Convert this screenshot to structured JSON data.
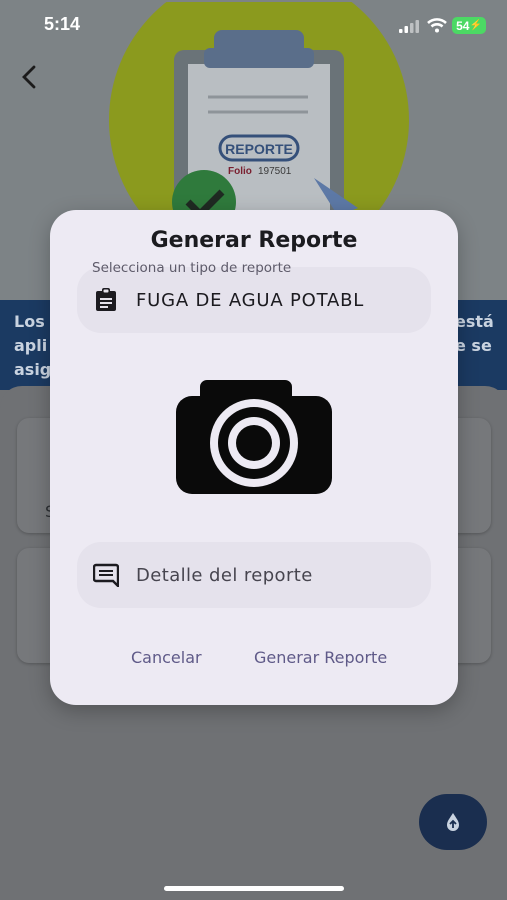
{
  "status_bar": {
    "time": "5:14",
    "battery": "54"
  },
  "hero": {
    "badge": "REPORTE",
    "folio_label": "Folio",
    "folio_number": "197501"
  },
  "background": {
    "band_left": [
      "Los",
      "apli",
      "asig"
    ],
    "band_right": [
      "está",
      "e se",
      ""
    ],
    "card_fragment": "S"
  },
  "dialog": {
    "title": "Generar Reporte",
    "select_label": "Selecciona un tipo de reporte",
    "report_type_value": "FUGA DE AGUA POTABL",
    "detail_placeholder": "Detalle del reporte",
    "cancel_label": "Cancelar",
    "generate_label": "Generar Reporte"
  },
  "icons": {
    "back": "chevron-left-icon",
    "clipboard": "clipboard-icon",
    "camera": "camera-icon",
    "comment": "comment-icon",
    "fab": "upload-icon"
  },
  "colors": {
    "dialog_bg": "#edeaf3",
    "field_bg": "#e5e2ec",
    "action_text": "#5f5a88",
    "band": "#1b3a62",
    "fab": "#1a2e4f"
  }
}
